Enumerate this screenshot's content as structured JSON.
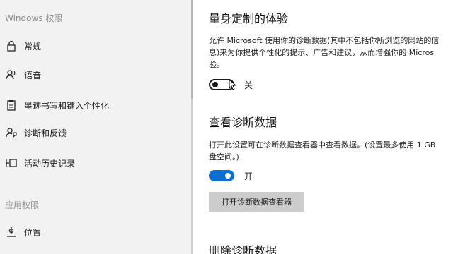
{
  "sidebar": {
    "section1_header": "Windows 权限",
    "items": [
      {
        "label": "常规",
        "icon": "lock-icon"
      },
      {
        "label": "语音",
        "icon": "speech-icon"
      },
      {
        "label": "墨迹书写和键入个性化",
        "icon": "clipboard-icon"
      },
      {
        "label": "诊断和反馈",
        "icon": "feedback-icon"
      },
      {
        "label": "活动历史记录",
        "icon": "activity-history-icon"
      }
    ],
    "section2_header": "应用权限",
    "items2": [
      {
        "label": "位置",
        "icon": "location-icon"
      }
    ]
  },
  "main": {
    "tailored": {
      "heading": "量身定制的体验",
      "desc_line1": "允许 Microsoft 使用你的诊断数据(其中不包括你所浏览的网站的信",
      "desc_line2": "息)来为你提供个性化的提示、广告和建议，从而增强你的 Micros",
      "desc_line3": "验。",
      "toggle_state": "off",
      "toggle_label": "关"
    },
    "viewer": {
      "heading": "查看诊断数据",
      "desc_line1": "打开此设置可在诊断数据查看器中查看数据。(设置最多使用 1 GB",
      "desc_line2": "盘空间。)",
      "toggle_state": "on",
      "toggle_label": "开",
      "button_label": "打开诊断数据查看器"
    },
    "delete": {
      "heading": "删除诊断数据"
    }
  },
  "colors": {
    "accent": "#0a6fd1",
    "sidebar_bg": "#f2f2f2",
    "button_bg": "#cccccc"
  }
}
